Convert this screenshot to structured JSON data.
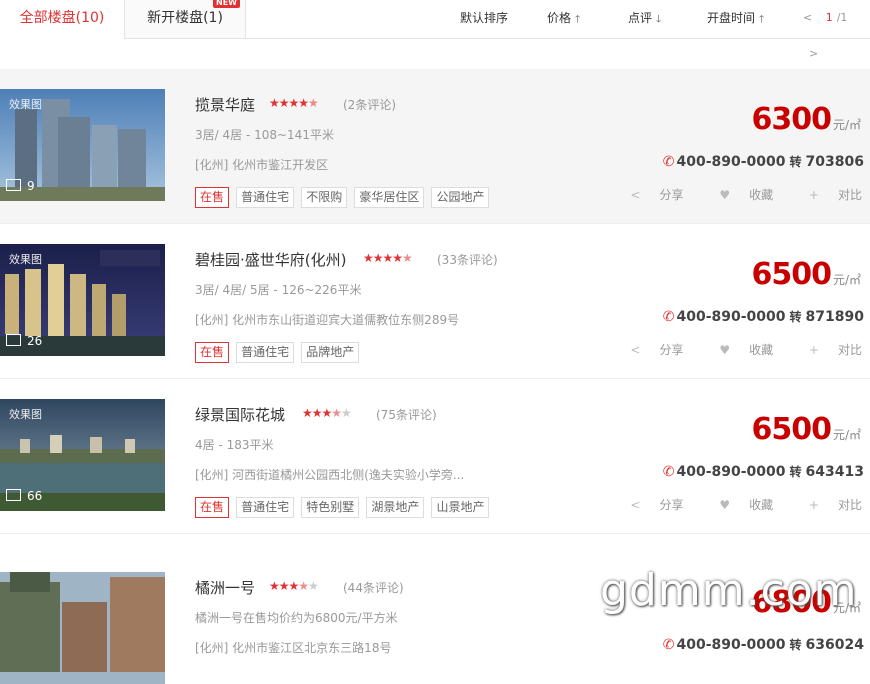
{
  "tabs": {
    "all": "全部楼盘(10)",
    "new": "新开楼盘(1)",
    "new_badge": "NEW"
  },
  "sort": {
    "default": "默认排序",
    "price": "价格",
    "review": "点评",
    "open_time": "开盘时间"
  },
  "pager": {
    "prev": "<",
    "current": "1",
    "total": "/1",
    "next": ">"
  },
  "listings": [
    {
      "name": "揽景华庭",
      "rating": 4.5,
      "reviews": "(2条评论)",
      "rooms": "3居/ 4居  -  108~141平米",
      "address": "[化州] 化州市鉴江开发区",
      "tags": [
        "在售",
        "普通住宅",
        "不限购",
        "豪华居住区",
        "公园地产"
      ],
      "photo_tag": "效果图",
      "photo_count": "9",
      "price": "6300",
      "unit": "元/㎡",
      "phone": "400-890-0000",
      "ext_label": "转",
      "ext": "703806"
    },
    {
      "name": "碧桂园·盛世华府(化州)",
      "rating": 4.5,
      "reviews": "(33条评论)",
      "rooms": "3居/ 4居/ 5居  -  126~226平米",
      "address": "[化州] 化州市东山街道迎宾大道儒教位东侧289号",
      "tags": [
        "在售",
        "普通住宅",
        "品牌地产"
      ],
      "photo_tag": "效果图",
      "photo_count": "26",
      "price": "6500",
      "unit": "元/㎡",
      "phone": "400-890-0000",
      "ext_label": "转",
      "ext": "871890"
    },
    {
      "name": "绿景国际花城",
      "rating": 3.5,
      "reviews": "(75条评论)",
      "rooms": "4居  -  183平米",
      "address": "[化州] 河西街道橘州公园西北侧(逸夫实验小学旁...",
      "tags": [
        "在售",
        "普通住宅",
        "特色别墅",
        "湖景地产",
        "山景地产"
      ],
      "photo_tag": "效果图",
      "photo_count": "66",
      "price": "6500",
      "unit": "元/㎡",
      "phone": "400-890-0000",
      "ext_label": "转",
      "ext": "643413"
    },
    {
      "name": "橘洲一号",
      "rating": 3.5,
      "reviews": "(44条评论)",
      "rooms": "橘洲一号在售均价约为6800元/平方米",
      "address": "[化州] 化州市鉴江区北京东三路18号",
      "tags": [],
      "photo_tag": "",
      "photo_count": "",
      "price": "6800",
      "unit": "元/㎡",
      "phone": "400-890-0000",
      "ext_label": "转",
      "ext": "636024"
    }
  ],
  "actions": {
    "share": "分享",
    "favorite": "收藏",
    "compare": "对比"
  },
  "watermark": "gdmm.com",
  "colors": {
    "accent": "#e03232",
    "price": "#c80000"
  }
}
